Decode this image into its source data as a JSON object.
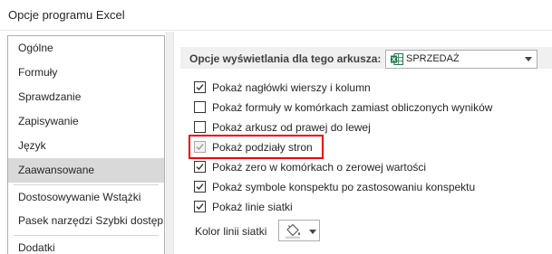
{
  "window": {
    "title": "Opcje programu Excel"
  },
  "sidebar": {
    "items": [
      {
        "label": "Ogólne",
        "selected": false
      },
      {
        "label": "Formuły",
        "selected": false
      },
      {
        "label": "Sprawdzanie",
        "selected": false
      },
      {
        "label": "Zapisywanie",
        "selected": false
      },
      {
        "label": "Język",
        "selected": false
      },
      {
        "label": "Zaawansowane",
        "selected": true
      },
      {
        "label": "Dostosowywanie Wstążki",
        "selected": false
      },
      {
        "label": "Pasek narzędzi Szybki dostęp",
        "selected": false
      },
      {
        "label": "Dodatki",
        "selected": false
      }
    ]
  },
  "section": {
    "label": "Opcje wyświetlania dla tego arkusza:",
    "sheet_select": {
      "value": "SPRZEDAŻ",
      "icon": "excel-sheet-icon"
    }
  },
  "options": [
    {
      "label": "Pokaż nagłówki wierszy i kolumn",
      "checked": true,
      "enabled": true
    },
    {
      "label": "Pokaż formuły w komórkach zamiast obliczonych wyników",
      "checked": false,
      "enabled": true
    },
    {
      "label": "Pokaż arkusz od prawej do lewej",
      "checked": false,
      "enabled": true
    },
    {
      "label": "Pokaż podziały stron",
      "checked": true,
      "enabled": false,
      "highlighted": true
    },
    {
      "label": "Pokaż zero w komórkach o zerowej wartości",
      "checked": true,
      "enabled": true
    },
    {
      "label": "Pokaż symbole konspektu po zastosowaniu konspektu",
      "checked": true,
      "enabled": true
    },
    {
      "label": "Pokaż linie siatki",
      "checked": true,
      "enabled": true
    }
  ],
  "gridlines": {
    "label": "Kolor linii siatki",
    "icon": "paint-bucket-icon"
  },
  "colors": {
    "highlight_border": "#e60000",
    "selected_nav": "#d9d9d9",
    "excel_green": "#217346"
  }
}
